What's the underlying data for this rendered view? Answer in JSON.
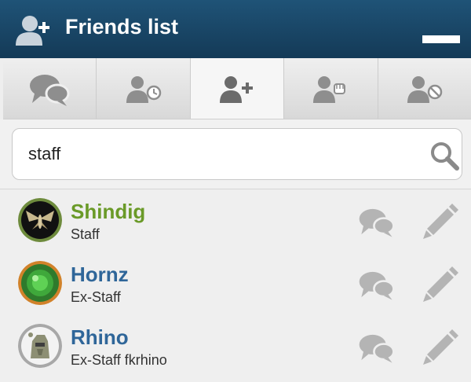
{
  "window": {
    "title": "Friends list",
    "title_icon": "add-friend-icon",
    "colors": {
      "titlebar": "#1b4a6c",
      "online_name": "#6a9a28",
      "offline_name": "#2f6699"
    }
  },
  "tabs": [
    {
      "icon": "chat-bubbles-icon",
      "active": false
    },
    {
      "icon": "friend-requests-clock-icon",
      "active": false
    },
    {
      "icon": "add-friend-icon",
      "active": true
    },
    {
      "icon": "fist-icon",
      "active": false
    },
    {
      "icon": "blocked-user-icon",
      "active": false
    }
  ],
  "search": {
    "value": "staff",
    "icon": "search-icon"
  },
  "friends": [
    {
      "name": "Shindig",
      "rank": "Staff",
      "status": "online"
    },
    {
      "name": "Hornz",
      "rank": "Ex-Staff",
      "status": "offline"
    },
    {
      "name": "Rhino",
      "rank": "Ex-Staff fkrhino",
      "status": "offline"
    }
  ]
}
